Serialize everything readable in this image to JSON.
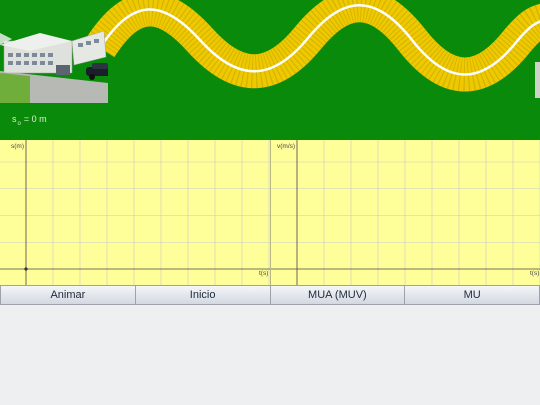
{
  "scene": {
    "position_label": "s",
    "position_subscript": "o",
    "position_value": "= 0 m",
    "colors": {
      "background": "#0a8a0a",
      "road": "#f0c800",
      "road_line": "#ffffff",
      "car": "#1a1f2a"
    }
  },
  "graphs": {
    "position": {
      "y_label": "s(m)",
      "x_label": "t(s)"
    },
    "velocity": {
      "y_label": "v(m/s)",
      "x_label": "t(s)"
    },
    "colors": {
      "background": "#ffff9a",
      "grid": "#c9c9c9",
      "axis": "#444444"
    }
  },
  "controls": {
    "animate_label": "Animar",
    "start_label": "Inicio",
    "mua_label": "MUA (MUV)",
    "mu_label": "MU"
  }
}
